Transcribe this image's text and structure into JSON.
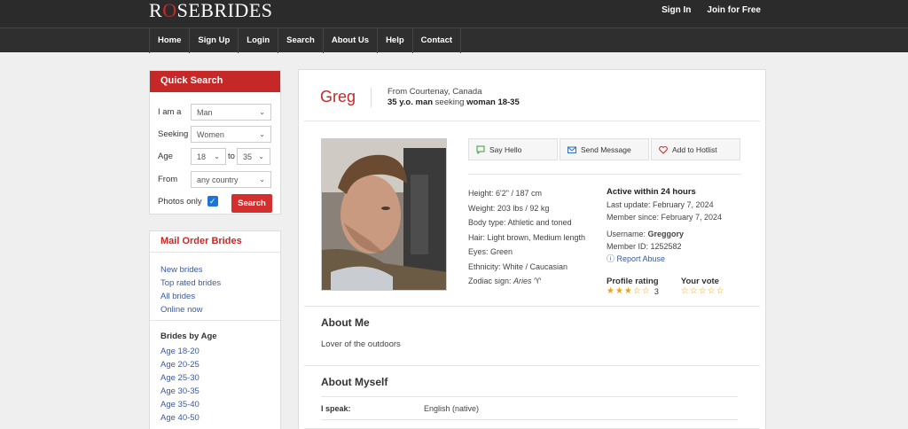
{
  "header": {
    "logo_pre": "R",
    "logo_o": "O",
    "logo_post": "SEBRIDES",
    "signin": "Sign In",
    "join": "Join for Free"
  },
  "nav": [
    "Home",
    "Sign Up",
    "Login",
    "Search",
    "About Us",
    "Help",
    "Contact"
  ],
  "quick_search": {
    "title": "Quick Search",
    "iam_label": "I am a",
    "iam_value": "Man",
    "seeking_label": "Seeking",
    "seeking_value": "Women",
    "age_label": "Age",
    "age_from": "18",
    "age_to_label": "to",
    "age_to": "35",
    "from_label": "From",
    "from_value": "any country",
    "photos_label": "Photos only",
    "photos_checked": true,
    "search_button": "Search"
  },
  "mail_order": {
    "title": "Mail Order Brides",
    "links": [
      "New brides",
      "Top rated brides",
      "All brides",
      "Online now"
    ],
    "age_title": "Brides by Age",
    "ages": [
      "Age 18-20",
      "Age 20-25",
      "Age 25-30",
      "Age 30-35",
      "Age 35-40",
      "Age 40-50"
    ]
  },
  "profile": {
    "name": "Greg",
    "from": "From Courtenay, Canada",
    "age_part": "35 y.o. man",
    "seeking_word": " seeking ",
    "seeking_part": "woman 18-35",
    "actions": {
      "hello": "Say Hello",
      "message": "Send Message",
      "hotlist": "Add to Hotlist"
    },
    "details": {
      "height": "Height: 6'2\" / 187 cm",
      "weight": "Weight: 203 lbs / 92 kg",
      "body": "Body type: Athletic and toned",
      "hair": "Hair: Light brown, Medium length",
      "eyes": "Eyes: Green",
      "ethnicity": "Ethnicity: White / Caucasian",
      "zodiac_label": "Zodiac sign: ",
      "zodiac_value": "Aries"
    },
    "status": {
      "active": "Active within 24 hours",
      "last_update": "Last update: February 7, 2024",
      "member_since": "Member since: February 7, 2024",
      "username_label": "Username: ",
      "username": "Greggory",
      "member_id": "Member ID: 1252582",
      "report": "Report Abuse"
    },
    "rating_label": "Profile rating",
    "rating_value": 3,
    "rating_count": "3",
    "vote_label": "Your vote",
    "about_me_title": "About Me",
    "about_me_text": "Lover of the outdoors",
    "about_myself_title": "About Myself",
    "speak_label": "I speak:",
    "speak_value": "English (native)"
  },
  "colors": {
    "brand_red": "#c62828",
    "link_blue": "#3a5a9c",
    "star": "#f0a30a"
  }
}
